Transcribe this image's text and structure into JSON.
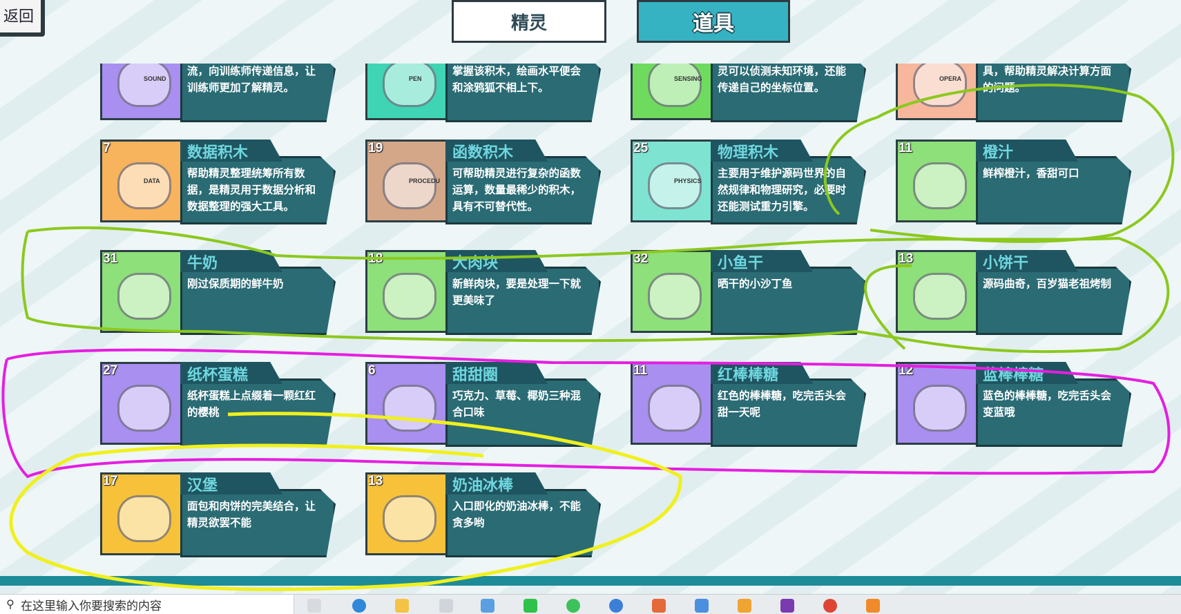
{
  "header": {
    "back_label": "返回",
    "tabs": [
      {
        "label": "精灵",
        "active": false
      },
      {
        "label": "道具",
        "active": true
      }
    ]
  },
  "cards": [
    {
      "id": "sound",
      "number": "",
      "name": "",
      "desc": "流，向训练师传递信息，让训练师更加了解精灵。",
      "thumb_color": "#a98ff0",
      "icon": "sound-block-icon",
      "badge": "SOUND"
    },
    {
      "id": "pen",
      "number": "",
      "name": "",
      "desc": "掌握该积木，绘画水平便会和涂鸦狐不相上下。",
      "thumb_color": "#3fd4b4",
      "icon": "pen-block-icon",
      "badge": "PEN"
    },
    {
      "id": "sensing",
      "number": "",
      "name": "",
      "desc": "灵可以侦测未知环境，还能传递自己的坐标位置。",
      "thumb_color": "#6fdb5e",
      "icon": "sensing-block-icon",
      "badge": "SENSING"
    },
    {
      "id": "operator",
      "number": "",
      "name": "",
      "desc": "具，帮助精灵解决计算方面的问题。",
      "thumb_color": "#f6b79c",
      "icon": "operator-block-icon",
      "badge": "OPERA"
    },
    {
      "id": "data",
      "number": "7",
      "name": "数据积木",
      "desc": "帮助精灵整理统筹所有数据，是精灵用于数据分析和数据整理的强大工具。",
      "thumb_color": "#f8b35d",
      "icon": "data-block-icon",
      "badge": "DATA"
    },
    {
      "id": "procedure",
      "number": "19",
      "name": "函数积木",
      "desc": "可帮助精灵进行复杂的函数运算，数量最稀少的积木，具有不可替代性。",
      "thumb_color": "#d4a789",
      "icon": "procedure-block-icon",
      "badge": "PROCEDU"
    },
    {
      "id": "physics",
      "number": "25",
      "name": "物理积木",
      "desc": "主要用于维护源码世界的自然规律和物理研究，必要时还能测试重力引擎。",
      "thumb_color": "#7fe3d2",
      "icon": "physics-block-icon",
      "badge": "PHYSICS"
    },
    {
      "id": "orange",
      "number": "11",
      "name": "橙汁",
      "desc": "鲜榨橙汁，香甜可口",
      "thumb_color": "#8ee07a",
      "icon": "orange-juice-icon",
      "badge": ""
    },
    {
      "id": "milk",
      "number": "31",
      "name": "牛奶",
      "desc": "刚过保质期的鲜牛奶",
      "thumb_color": "#8ee07a",
      "icon": "milk-carton-icon",
      "badge": ""
    },
    {
      "id": "meat",
      "number": "18",
      "name": "大肉块",
      "desc": "新鲜肉块，要是处理一下就更美味了",
      "thumb_color": "#8ee07a",
      "icon": "meat-chunk-icon",
      "badge": ""
    },
    {
      "id": "fish",
      "number": "32",
      "name": "小鱼干",
      "desc": "晒干的小沙丁鱼",
      "thumb_color": "#8ee07a",
      "icon": "dried-fish-icon",
      "badge": ""
    },
    {
      "id": "cookie",
      "number": "13",
      "name": "小饼干",
      "desc": "源码曲奇，百岁猫老祖烤制",
      "thumb_color": "#8ee07a",
      "icon": "cookie-icon",
      "badge": ""
    },
    {
      "id": "cupcake",
      "number": "27",
      "name": "纸杯蛋糕",
      "desc": "纸杯蛋糕上点缀着一颗红红的樱桃",
      "thumb_color": "#a98ff0",
      "icon": "cupcake-icon",
      "badge": ""
    },
    {
      "id": "donut",
      "number": "6",
      "name": "甜甜圈",
      "desc": "巧克力、草莓、椰奶三种混合口味",
      "thumb_color": "#a98ff0",
      "icon": "donut-icon",
      "badge": ""
    },
    {
      "id": "red-lollipop",
      "number": "11",
      "name": "红棒棒糖",
      "desc": "红色的棒棒糖，吃完舌头会甜一天呢",
      "thumb_color": "#a98ff0",
      "icon": "red-lollipop-icon",
      "badge": ""
    },
    {
      "id": "blue-lollipop",
      "number": "12",
      "name": "蓝棒棒糖",
      "desc": "蓝色的棒棒糖，吃完舌头会变蓝哦",
      "thumb_color": "#a98ff0",
      "icon": "blue-lollipop-icon",
      "badge": ""
    },
    {
      "id": "burger",
      "number": "17",
      "name": "汉堡",
      "desc": "面包和肉饼的完美结合，让精灵欲罢不能",
      "thumb_color": "#f7c23a",
      "icon": "burger-icon",
      "badge": ""
    },
    {
      "id": "icecream",
      "number": "13",
      "name": "奶油冰棒",
      "desc": "入口即化的奶油冰棒，不能贪多哟",
      "thumb_color": "#f7c23a",
      "icon": "ice-cream-bar-icon",
      "badge": ""
    }
  ],
  "taskbar": {
    "search_placeholder": "在这里输入你要搜索的内容"
  }
}
